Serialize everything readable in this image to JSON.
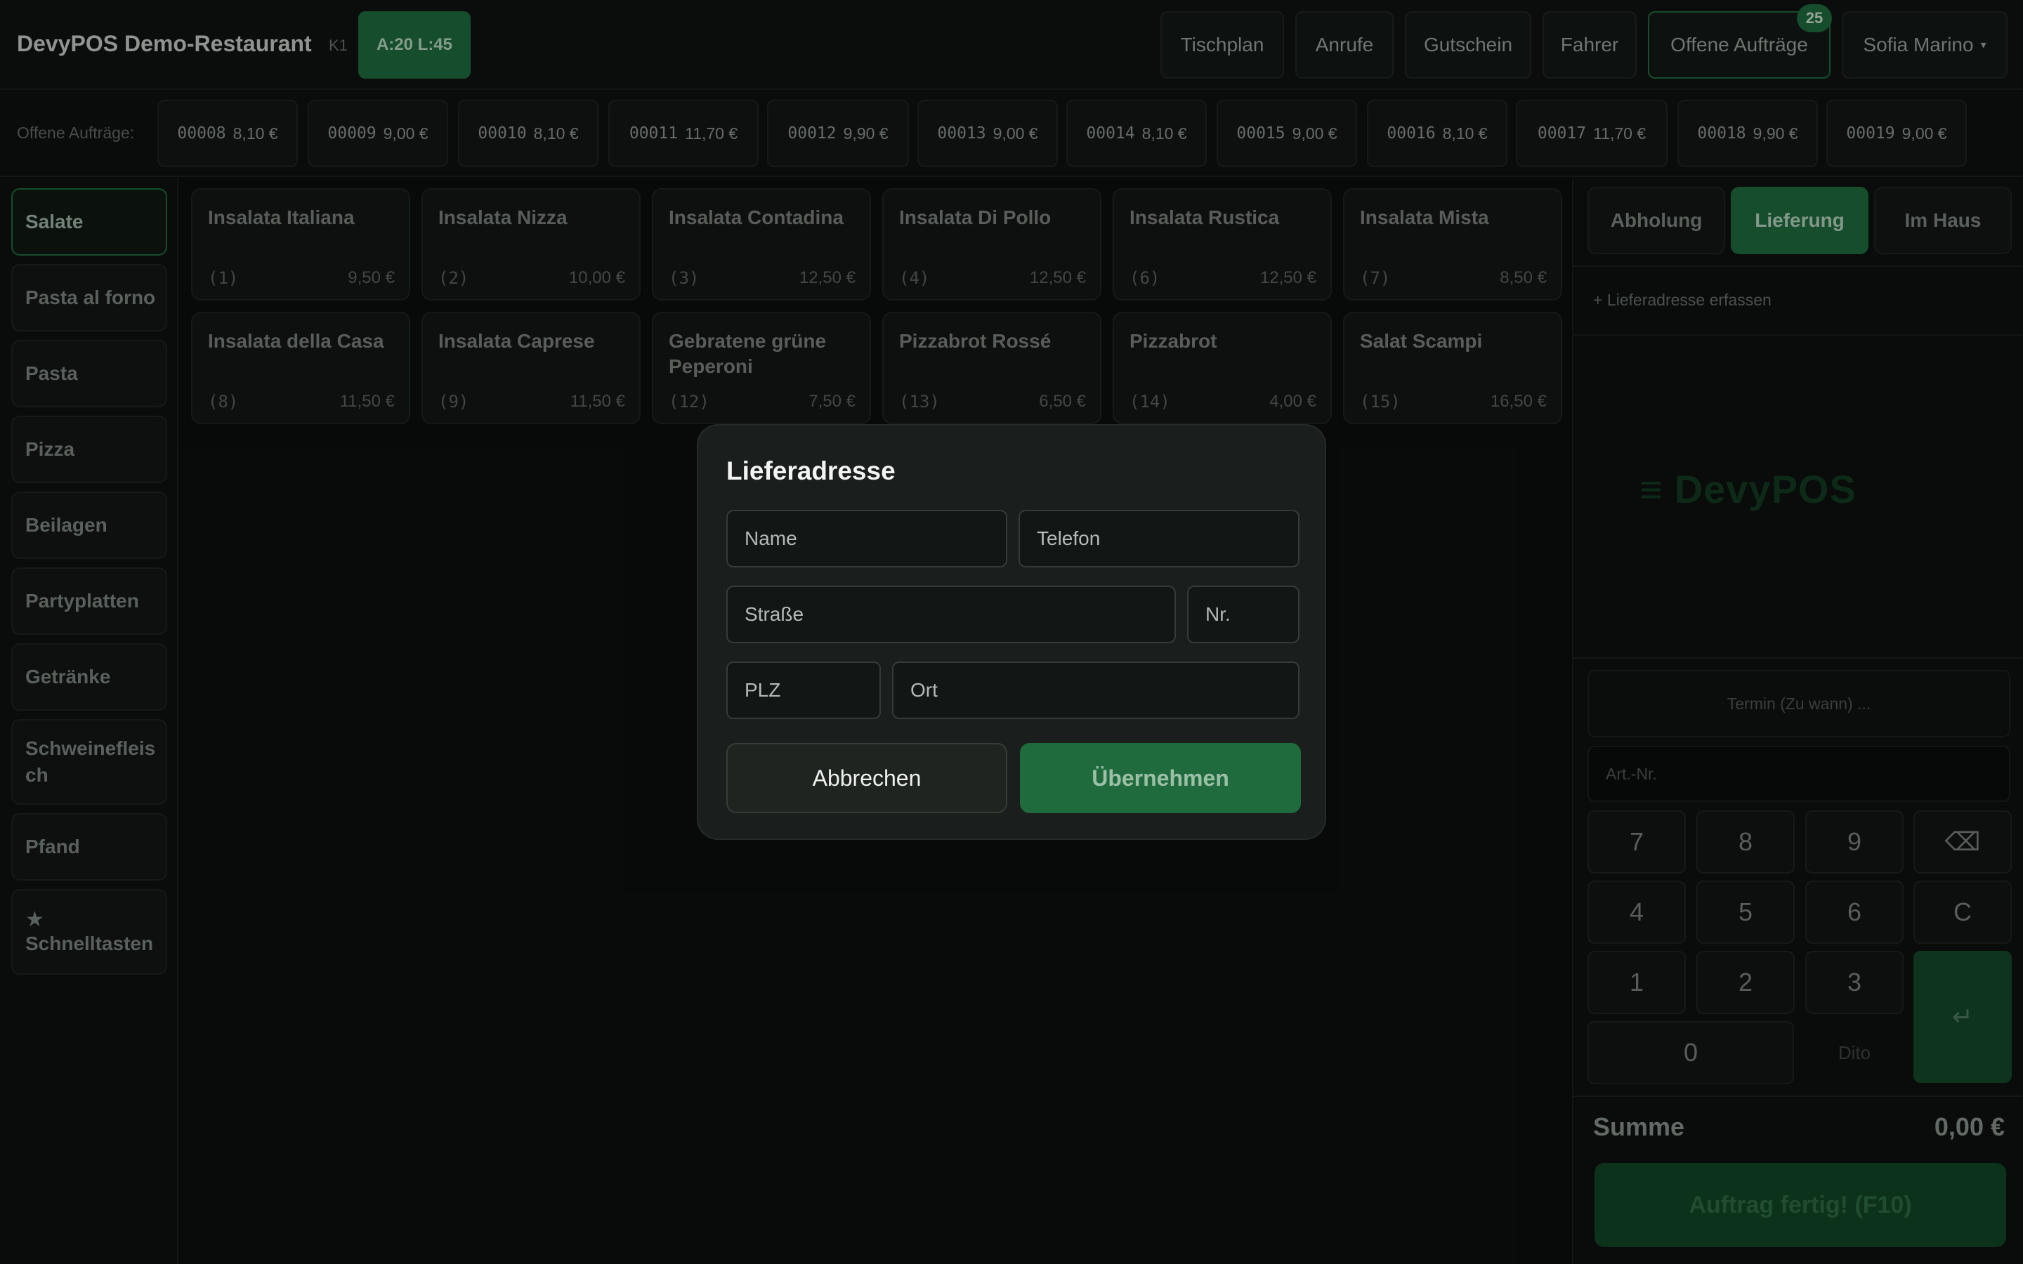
{
  "header": {
    "brand": "DevyPOS Demo-Restaurant",
    "register": "K1",
    "status_pill": "A:20 L:45",
    "buttons": {
      "tischplan": "Tischplan",
      "anrufe": "Anrufe",
      "gutschein": "Gutschein",
      "fahrer": "Fahrer",
      "offene_auftraege": "Offene Aufträge",
      "offene_badge": "25"
    },
    "user": "Sofia Marino",
    "caret": "▾"
  },
  "orders_bar": {
    "label": "Offene Aufträge:",
    "orders": [
      {
        "num": "00008",
        "amount": "8,10 €"
      },
      {
        "num": "00009",
        "amount": "9,00 €"
      },
      {
        "num": "00010",
        "amount": "8,10 €"
      },
      {
        "num": "00011",
        "amount": "11,70 €"
      },
      {
        "num": "00012",
        "amount": "9,90 €"
      },
      {
        "num": "00013",
        "amount": "9,00 €"
      },
      {
        "num": "00014",
        "amount": "8,10 €"
      },
      {
        "num": "00015",
        "amount": "9,00 €"
      },
      {
        "num": "00016",
        "amount": "8,10 €"
      },
      {
        "num": "00017",
        "amount": "11,70 €"
      },
      {
        "num": "00018",
        "amount": "9,90 €"
      },
      {
        "num": "00019",
        "amount": "9,00 €"
      }
    ]
  },
  "categories": [
    {
      "label": "Salate",
      "active": true
    },
    {
      "label": "Pasta al forno"
    },
    {
      "label": "Pasta"
    },
    {
      "label": "Pizza"
    },
    {
      "label": "Beilagen"
    },
    {
      "label": "Partyplatten"
    },
    {
      "label": "Getränke"
    },
    {
      "label": "Schweinefleisch"
    },
    {
      "label": "Pfand"
    },
    {
      "label": "Schnelltasten",
      "star": "★"
    }
  ],
  "products": [
    {
      "name": "Insalata Italiana",
      "nr": "(1)",
      "price": "9,50 €"
    },
    {
      "name": "Insalata Nizza",
      "nr": "(2)",
      "price": "10,00 €"
    },
    {
      "name": "Insalata Contadina",
      "nr": "(3)",
      "price": "12,50 €"
    },
    {
      "name": "Insalata Di Pollo",
      "nr": "(4)",
      "price": "12,50 €"
    },
    {
      "name": "Insalata Rustica",
      "nr": "(6)",
      "price": "12,50 €"
    },
    {
      "name": "Insalata Mista",
      "nr": "(7)",
      "price": "8,50 €"
    },
    {
      "name": "Insalata della Casa",
      "nr": "(8)",
      "price": "11,50 €"
    },
    {
      "name": "Insalata Caprese",
      "nr": "(9)",
      "price": "11,50 €"
    },
    {
      "name": "Gebratene grüne Peperoni",
      "nr": "(12)",
      "price": "7,50 €"
    },
    {
      "name": "Pizzabrot Rossé",
      "nr": "(13)",
      "price": "6,50 €"
    },
    {
      "name": "Pizzabrot",
      "nr": "(14)",
      "price": "4,00 €"
    },
    {
      "name": "Salat Scampi",
      "nr": "(15)",
      "price": "16,50 €"
    }
  ],
  "right_panel": {
    "tabs": {
      "abholung": "Abholung",
      "lieferung": "Lieferung",
      "im_haus": "Im Haus"
    },
    "add_address": "+ Lieferadresse erfassen",
    "logo_text": "DevyPOS",
    "termin_placeholder": "Termin (Zu wann) ...",
    "artnr_placeholder": "Art.-Nr.",
    "keypad": {
      "k7": "7",
      "k8": "8",
      "k9": "9",
      "backspace": "⌫",
      "k4": "4",
      "k5": "5",
      "k6": "6",
      "clear": "C",
      "k1": "1",
      "k2": "2",
      "k3": "3",
      "enter": "↵",
      "k0": "0",
      "dito": "Dito"
    },
    "summe_label": "Summe",
    "summe_value": "0,00 €",
    "finish_button": "Auftrag fertig! (F10)"
  },
  "modal": {
    "title": "Lieferadresse",
    "fields": {
      "name": "Name",
      "telefon": "Telefon",
      "strasse": "Straße",
      "nr": "Nr.",
      "plz": "PLZ",
      "ort": "Ort"
    },
    "cancel": "Abbrechen",
    "apply": "Übernehmen"
  },
  "colors": {
    "accent": "#1f6b3d",
    "background": "#0b0f0d",
    "modal_bg": "#1a1e1c"
  }
}
